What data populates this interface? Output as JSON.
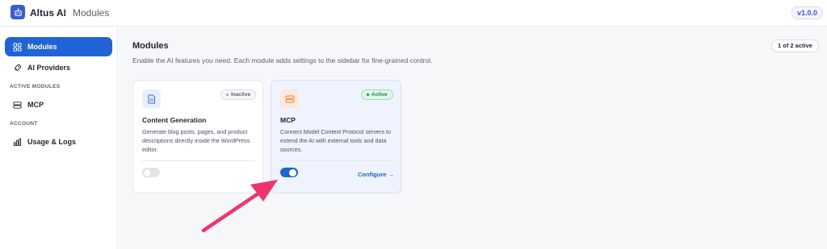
{
  "header": {
    "app_name": "Altus AI",
    "separator": "›",
    "breadcrumb": "Modules",
    "version": "v1.0.0"
  },
  "sidebar": {
    "items": [
      {
        "label": "Modules",
        "icon": "modules-grid-icon",
        "active": true
      },
      {
        "label": "AI Providers",
        "icon": "rocket-icon",
        "active": false
      }
    ],
    "active_modules_label": "ACTIVE MODULES",
    "active_modules": [
      {
        "label": "MCP",
        "icon": "server-icon"
      }
    ],
    "account_label": "ACCOUNT",
    "account_items": [
      {
        "label": "Usage & Logs",
        "icon": "bar-chart-icon"
      }
    ]
  },
  "main": {
    "title": "Modules",
    "subtitle": "Enable the AI features you need. Each module adds settings to the sidebar for fine-grained control.",
    "active_count": "1 of 2 active",
    "cards": [
      {
        "title": "Content Generation",
        "description": "Generate blog posts, pages, and product descriptions directly inside the WordPress editor.",
        "status": "Inactive",
        "enabled": false,
        "icon": "document-icon"
      },
      {
        "title": "MCP",
        "description": "Connect Model Context Protocol servers to extend the AI with external tools and data sources.",
        "status": "Active",
        "enabled": true,
        "action": "Configure →",
        "icon": "server-stack-icon"
      }
    ]
  },
  "colors": {
    "accent": "#1f63d6",
    "logo": "#3b5bdb",
    "active_status_bg": "#dff6e8",
    "active_status_text": "#1e8a4c",
    "annotation_arrow": "#f0356e"
  }
}
